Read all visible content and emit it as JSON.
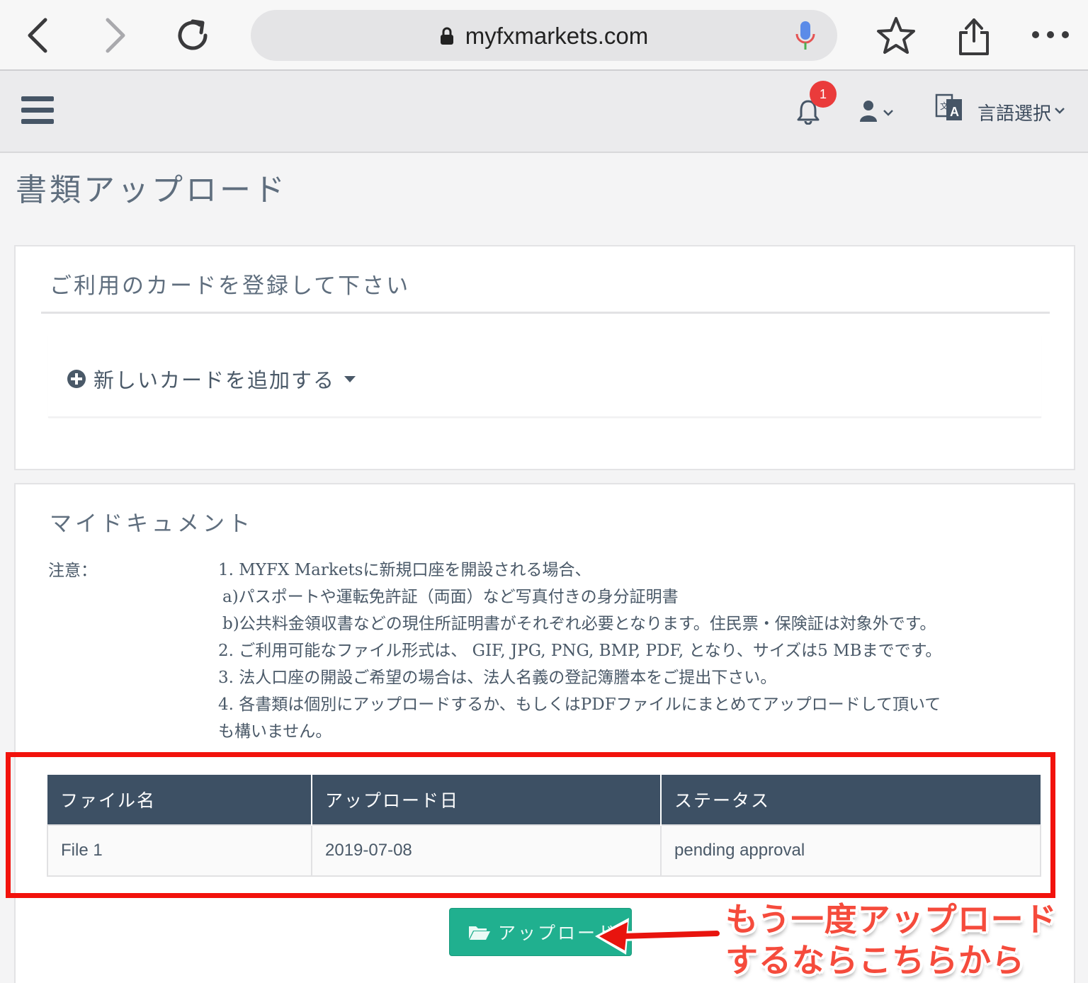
{
  "browser": {
    "url": "myfxmarkets.com"
  },
  "header": {
    "notification_count": "1",
    "language_label": "言語選択"
  },
  "page": {
    "title": "書類アップロード"
  },
  "card_panel": {
    "title": "ご利用のカードを登録して下さい",
    "add_card_label": "新しいカードを追加する"
  },
  "docs_panel": {
    "title": "マイドキュメント",
    "notice_label": "注意：",
    "notice_lines": [
      "1. MYFX Marketsに新規口座を開設される場合、",
      "a)パスポートや運転免許証（両面）など写真付きの身分証明書",
      "b)公共料金領収書などの現住所証明書がそれぞれ必要となります。住民票・保険証は対象外です。",
      "2. ご利用可能なファイル形式は、 GIF, JPG, PNG, BMP, PDF, となり、サイズは5 MBまでです。",
      "3. 法人口座の開設ご希望の場合は、法人名義の登記簿謄本をご提出下さい。",
      "4. 各書類は個別にアップロードするか、もしくはPDFファイルにまとめてアップロードして頂いて",
      "も構いません。"
    ],
    "table": {
      "headers": [
        "ファイル名",
        "アップロード日",
        "ステータス"
      ],
      "rows": [
        [
          "File 1",
          "2019-07-08",
          "pending approval"
        ]
      ]
    },
    "upload_button_label": "アップロード"
  },
  "annotation": {
    "callout_line1": "もう一度アップロード",
    "callout_line2": "するならこちらから",
    "color": "#f2120c"
  },
  "colors": {
    "table_header": "#3d5064",
    "upload_button": "#20b08f",
    "badge": "#ea3b3b"
  }
}
